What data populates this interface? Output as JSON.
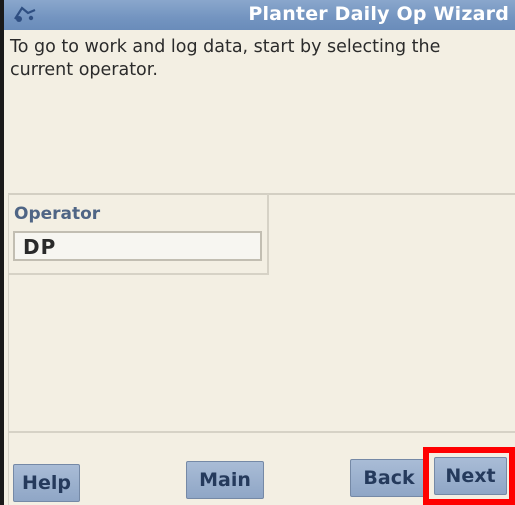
{
  "title_bar": {
    "title": "Planter Daily Op Wizard",
    "icon": "tractor-icon"
  },
  "instructions": "To go to work and log data, start by selecting the current operator.",
  "operator": {
    "label": "Operator",
    "value": "DP"
  },
  "buttons": {
    "help": "Help",
    "main": "Main",
    "back": "Back",
    "next": "Next"
  },
  "colors": {
    "title_bar": "#7394c0",
    "background": "#f3efe3",
    "button": "#9db2cf",
    "button_text": "#253a5c",
    "highlight": "#ff0000"
  }
}
